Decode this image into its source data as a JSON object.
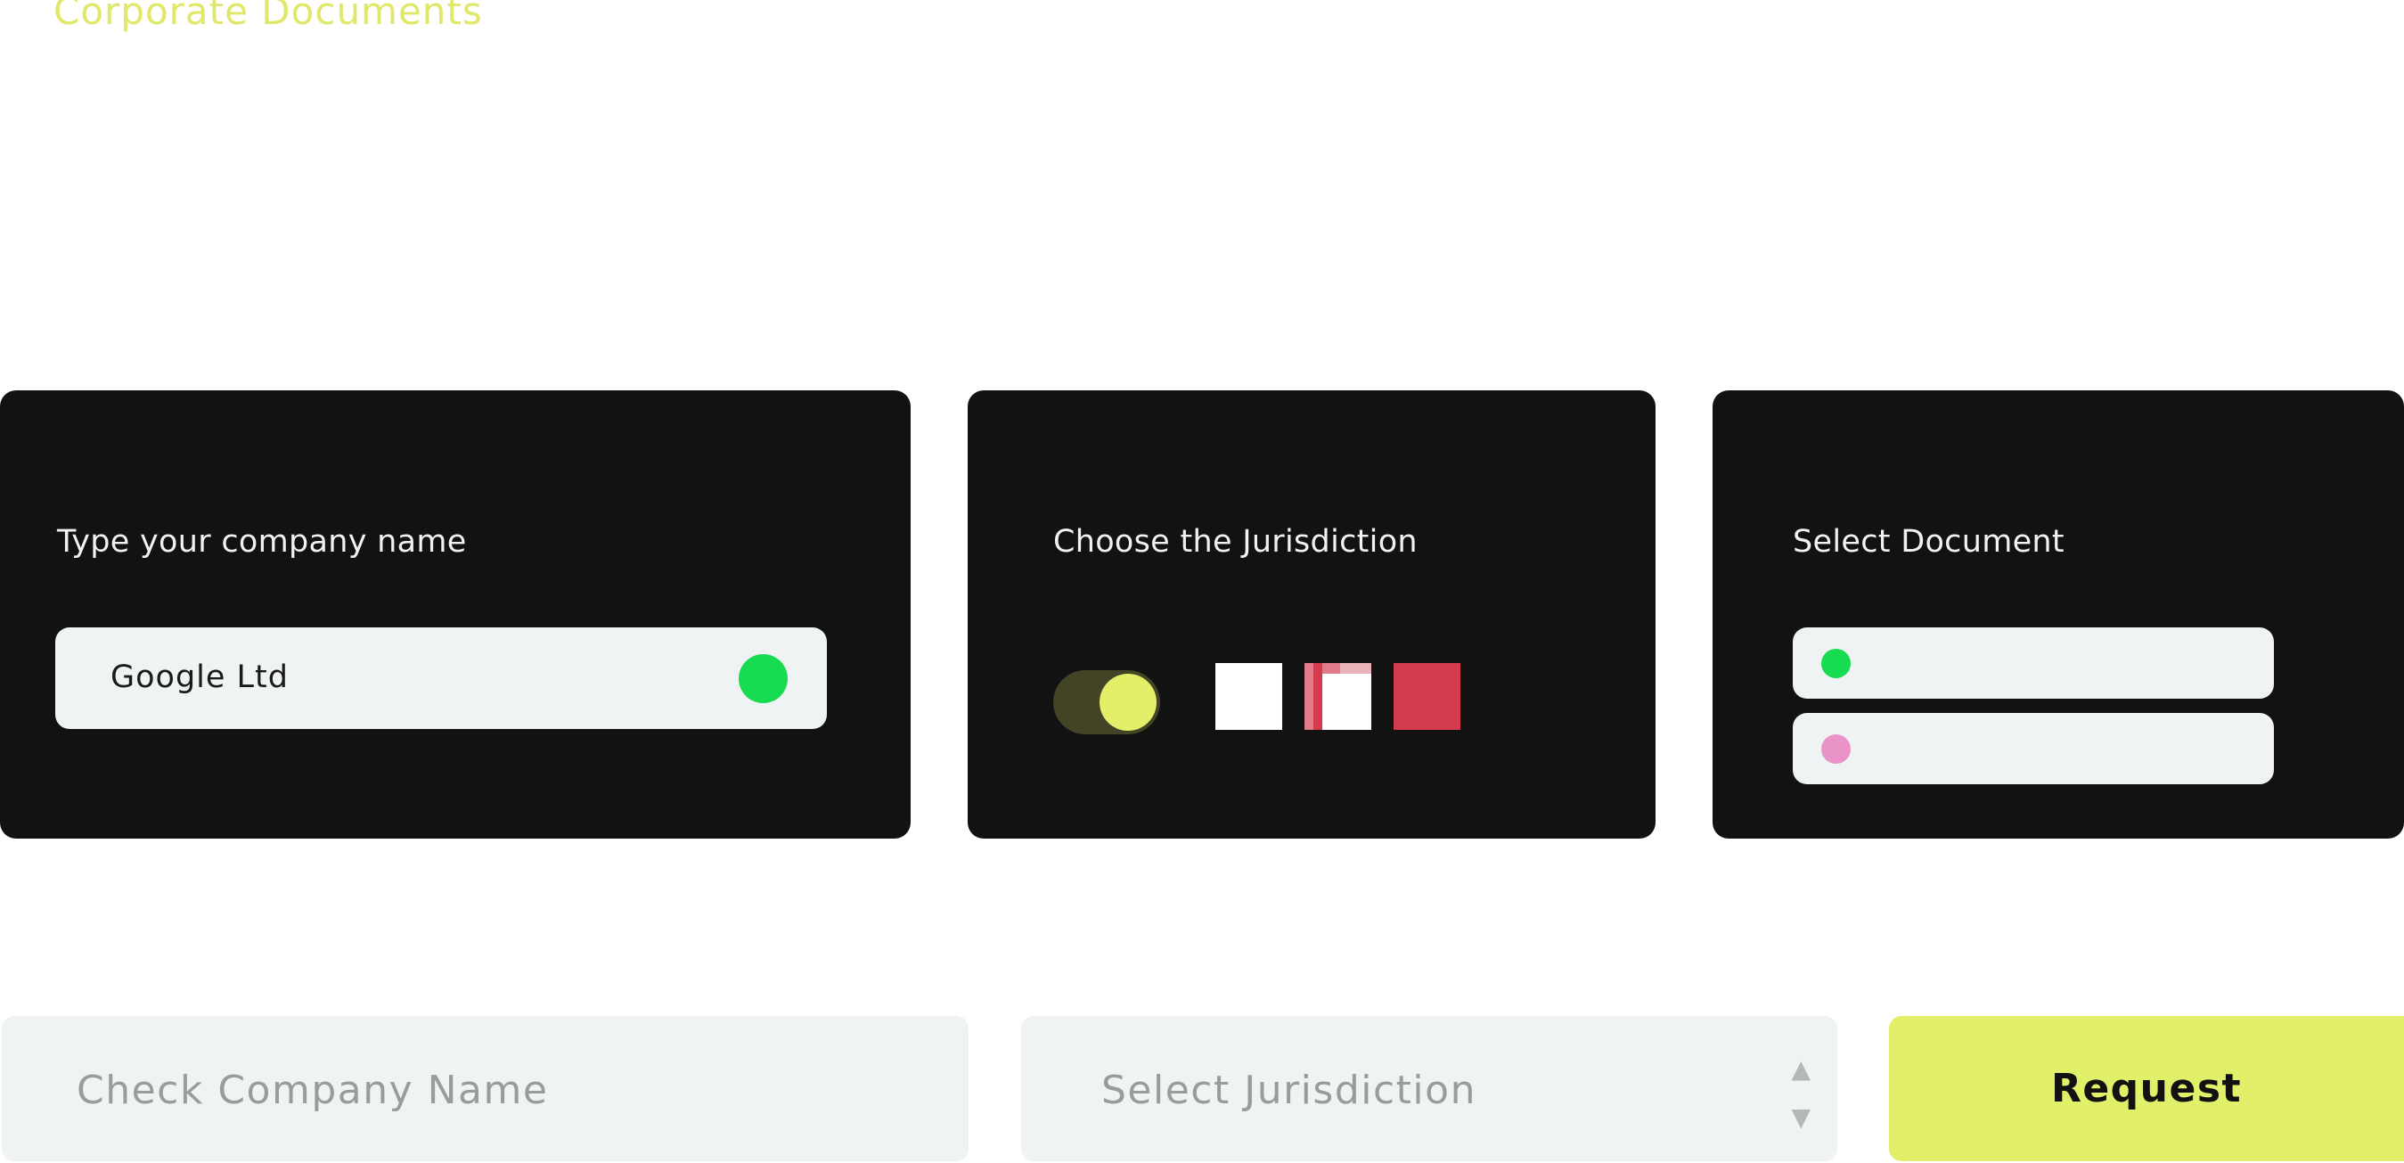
{
  "header": {
    "title": "Corporate Documents"
  },
  "cards": {
    "company": {
      "heading": "Type your company name",
      "input_value": "Google Ltd",
      "status_color": "#17db51"
    },
    "jurisdiction": {
      "heading": "Choose the Jurisdiction",
      "toggle_on": true,
      "flags": [
        "white-flag",
        "red-white-flag",
        "red-flag"
      ]
    },
    "document": {
      "heading": "Select Document",
      "options": [
        {
          "dot_color": "#17db51"
        },
        {
          "dot_color": "#e993c9"
        }
      ]
    }
  },
  "form": {
    "check_company_placeholder": "Check Company Name",
    "select_jurisdiction_placeholder": "Select Jurisdiction",
    "request_label": "Request"
  },
  "colors": {
    "accent": "#e2ef68",
    "card_background": "#121212",
    "field_background": "#eff3f3",
    "flag_red": "#d43b4f"
  }
}
